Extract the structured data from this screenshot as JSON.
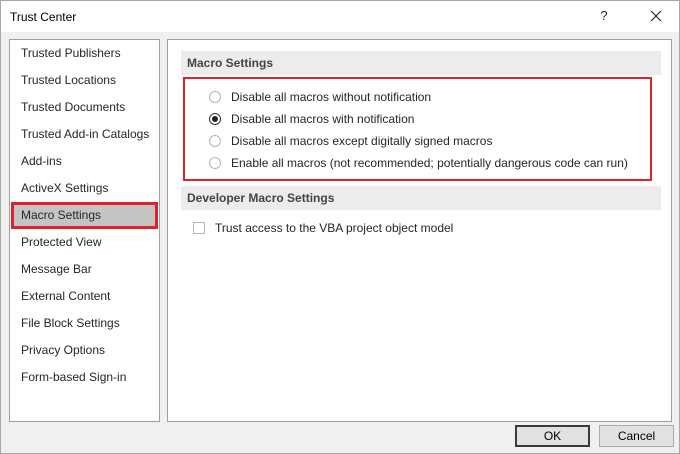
{
  "window": {
    "title": "Trust Center",
    "help_label": "?"
  },
  "nav": {
    "items": [
      {
        "label": "Trusted Publishers"
      },
      {
        "label": "Trusted Locations"
      },
      {
        "label": "Trusted Documents"
      },
      {
        "label": "Trusted Add-in Catalogs"
      },
      {
        "label": "Add-ins"
      },
      {
        "label": "ActiveX Settings"
      },
      {
        "label": "Macro Settings",
        "selected": true
      },
      {
        "label": "Protected View"
      },
      {
        "label": "Message Bar"
      },
      {
        "label": "External Content"
      },
      {
        "label": "File Block Settings"
      },
      {
        "label": "Privacy Options"
      },
      {
        "label": "Form-based Sign-in"
      }
    ]
  },
  "macro_settings": {
    "header": "Macro Settings",
    "options": [
      {
        "label": "Disable all macros without notification",
        "checked": false
      },
      {
        "label": "Disable all macros with notification",
        "checked": true
      },
      {
        "label": "Disable all macros except digitally signed macros",
        "checked": false
      },
      {
        "label": "Enable all macros (not recommended; potentially dangerous code can run)",
        "checked": false
      }
    ]
  },
  "developer_settings": {
    "header": "Developer Macro Settings",
    "vba_access_label": "Trust access to the VBA project object model",
    "vba_access_checked": false
  },
  "buttons": {
    "ok_label": "OK",
    "cancel_label": "Cancel"
  },
  "colors": {
    "highlight_red": "#e0212b",
    "selected_bg": "#c4c4c4"
  }
}
